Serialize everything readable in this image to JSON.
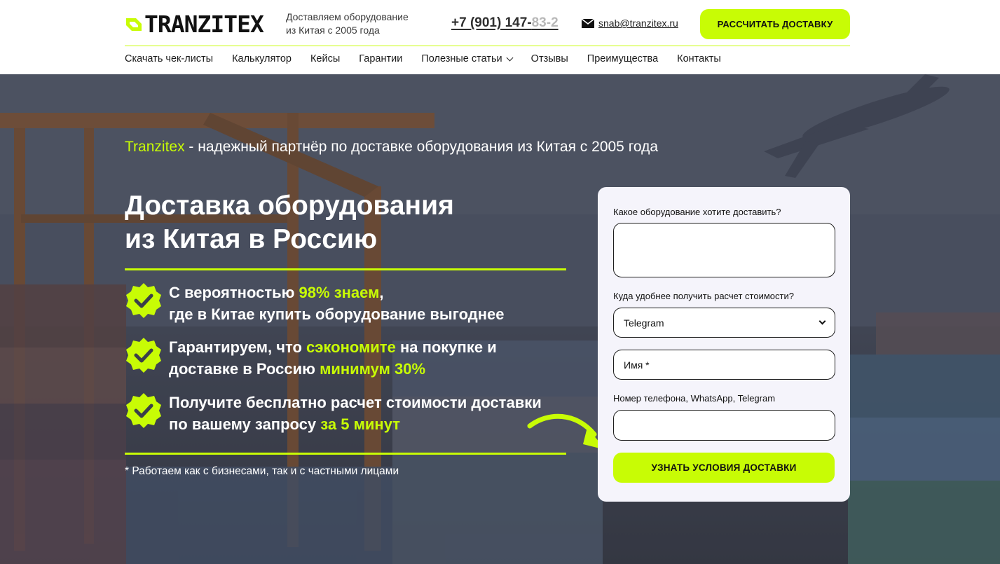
{
  "header": {
    "logo_text": "TRANZITEX",
    "tagline_line1": "Доставляем оборудование",
    "tagline_line2": "из Китая с 2005 года",
    "phone_visible": "+7 (901) 147-",
    "phone_faded": "83-2",
    "email": "snab@tranzitex.ru",
    "cta_label": "РАССЧИТАТЬ ДОСТАВКУ",
    "accent_color": "#c8fc05"
  },
  "nav": {
    "items": [
      {
        "label": "Скачать чек-листы"
      },
      {
        "label": "Калькулятор"
      },
      {
        "label": "Кейсы"
      },
      {
        "label": "Гарантии"
      },
      {
        "label": "Полезные статьи"
      },
      {
        "label": "Отзывы"
      },
      {
        "label": "Преимущества"
      },
      {
        "label": "Контакты"
      }
    ]
  },
  "hero": {
    "subtitle_brand": "Tranzitex",
    "subtitle_rest": " - надежный партнёр  по доставке оборудования из Китая с 2005 года",
    "title_line1": "Доставка оборудования",
    "title_line2": "из Китая в Россию",
    "benefits": [
      {
        "p1": "С вероятностью ",
        "h1": "98% знаем",
        "p2": ",",
        "p3": "где в Китае купить оборудование выгоднее"
      },
      {
        "p1": "Гарантируем, что ",
        "h1": "сэкономите",
        "p2": " на покупке и доставке в Россию ",
        "h2": "минимум 30%"
      },
      {
        "p1": "Получите бесплатно расчет стоимости доставки по вашему запросу ",
        "h1": "за 5 минут"
      }
    ],
    "footnote": "* Работаем как с бизнесами, так и с частными лицами"
  },
  "form": {
    "q1_label": "Какое оборудование хотите доставить?",
    "q1_value": "",
    "q2_label": "Куда удобнее получить расчет стоимости?",
    "q2_selected": "Telegram",
    "name_placeholder": "Имя *",
    "phone_label": "Номер телефона, WhatsApp, Telegram",
    "phone_value": "",
    "submit_label": "УЗНАТЬ УСЛОВИЯ ДОСТАВКИ"
  }
}
